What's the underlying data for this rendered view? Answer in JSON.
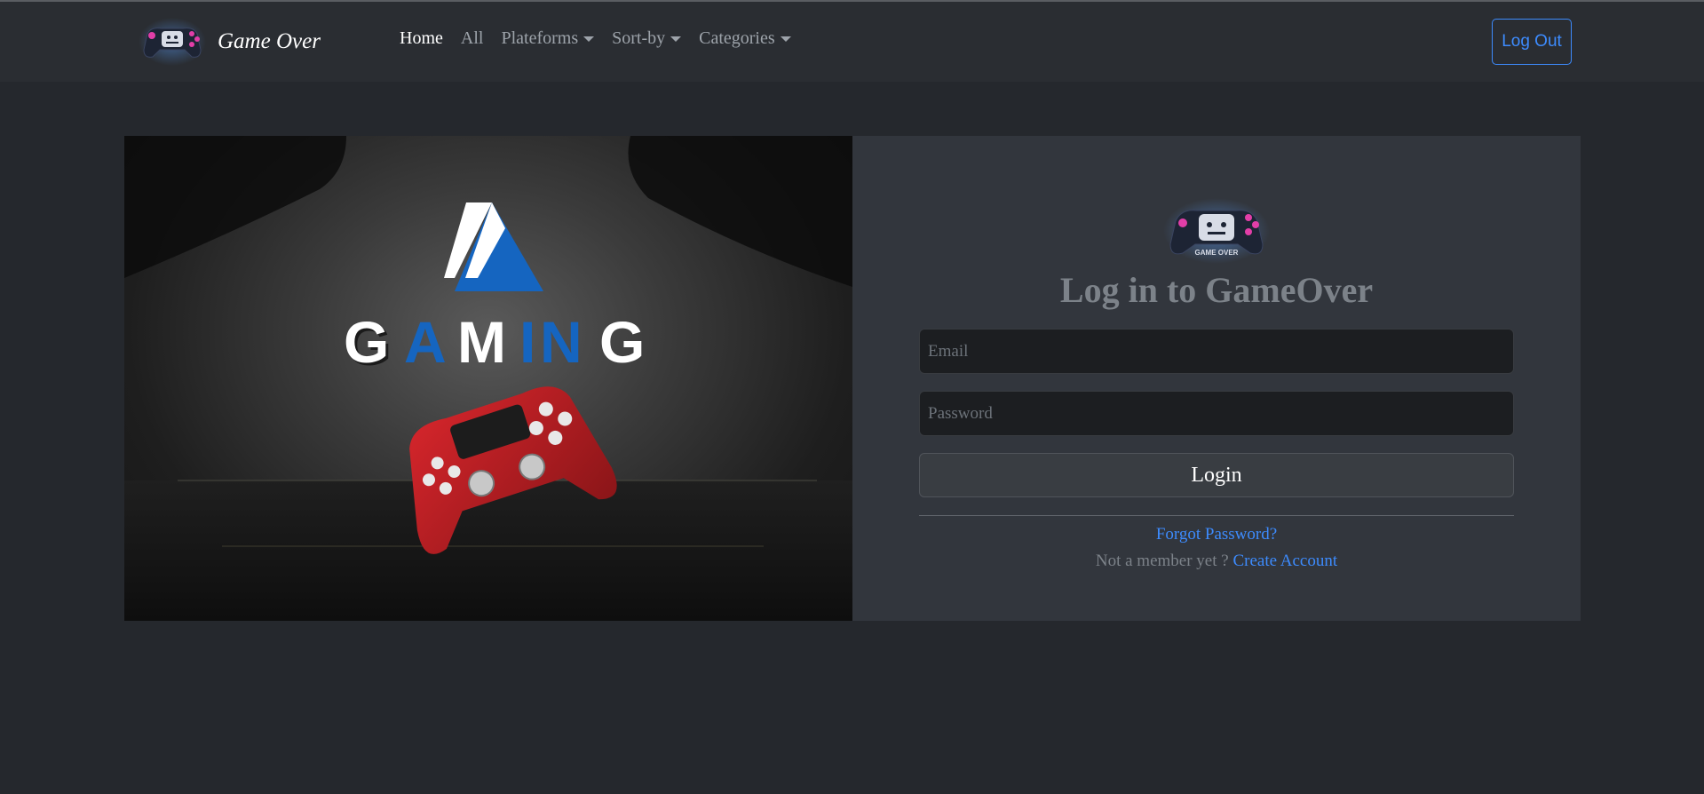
{
  "nav": {
    "brand_name": "Game Over",
    "links": [
      {
        "label": "Home",
        "active": true
      },
      {
        "label": "All"
      },
      {
        "label": "Plateforms",
        "dropdown": true
      },
      {
        "label": "Sort-by",
        "dropdown": true
      },
      {
        "label": "Categories",
        "dropdown": true
      }
    ],
    "logout_label": "Log Out"
  },
  "hero": {
    "text": "GAMING",
    "logo_letter_icon": "triangle-a-logo-icon",
    "controller_icon": "red-gamepad-icon"
  },
  "login": {
    "logo_text": "GAME OVER",
    "title": "Log in to GameOver",
    "email_placeholder": "Email",
    "password_placeholder": "Password",
    "submit_label": "Login",
    "forgot_label": "Forgot Password?",
    "register_prompt": "Not a member yet ? ",
    "register_link": "Create Account"
  },
  "colors": {
    "background": "#25282d",
    "navbar": "#2a2d32",
    "card": "#32363d",
    "link": "#3d8bfd",
    "hero_accent": "#1565c0",
    "controller": "#b81e24"
  }
}
